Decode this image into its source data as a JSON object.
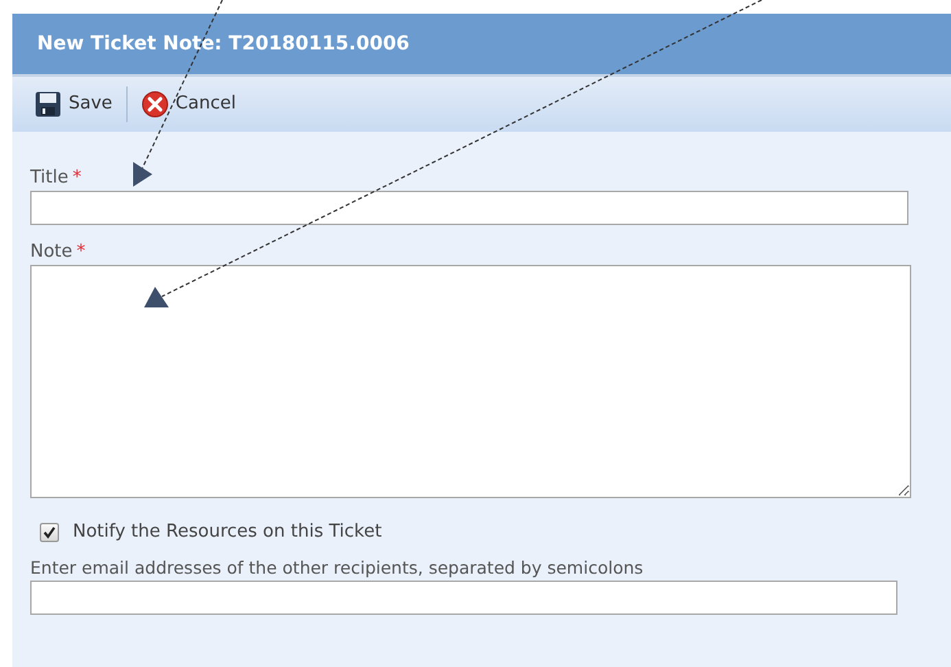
{
  "dialog": {
    "title": "New Ticket Note: T20180115.0006"
  },
  "toolbar": [
    {
      "kind": "save",
      "label": "Save"
    },
    {
      "kind": "cancel",
      "label": "Cancel"
    }
  ],
  "fields": [
    {
      "kind": "input",
      "label": "Title",
      "required_mark": "*"
    },
    {
      "kind": "textarea",
      "label": "Note",
      "required_mark": "*"
    }
  ],
  "notify": {
    "label": "Notify the Resources on this Ticket",
    "checked": true
  },
  "recipients": {
    "label": "Enter email addresses of the other recipients, separated by semicolons"
  }
}
